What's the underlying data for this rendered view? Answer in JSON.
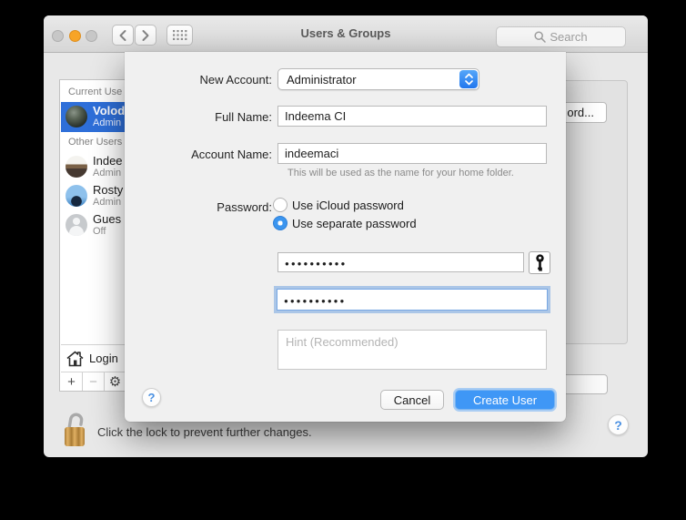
{
  "titlebar": {
    "title": "Users & Groups",
    "search_placeholder": "Search"
  },
  "sidebar": {
    "section_current": "Current Use",
    "section_other": "Other Users",
    "users": [
      {
        "name": "Volod",
        "role": "Admin"
      },
      {
        "name": "Indee",
        "role": "Admin"
      },
      {
        "name": "Rosty",
        "role": "Admin"
      },
      {
        "name": "Gues",
        "role": "Off"
      }
    ],
    "login_label": "Login",
    "add_label": "+",
    "remove_label": "−",
    "gear_glyph": "⚙"
  },
  "background_pane": {
    "partial_password_button": "ord..."
  },
  "sheet": {
    "new_account_label": "New Account:",
    "new_account_value": "Administrator",
    "full_name_label": "Full Name:",
    "full_name_value": "Indeema CI",
    "account_name_label": "Account Name:",
    "account_name_value": "indeemaci",
    "account_name_help": "This will be used as the name for your home folder.",
    "password_label": "Password:",
    "radio_icloud_label": "Use iCloud password",
    "radio_separate_label": "Use separate password",
    "password_value": "●●●●●●●●●●",
    "verify_value": "●●●●●●●●●●",
    "hint_placeholder": "Hint (Recommended)",
    "help_label": "?",
    "cancel_label": "Cancel",
    "create_label": "Create User"
  },
  "footer": {
    "lock_text": "Click the lock to prevent further changes.",
    "help_label": "?"
  },
  "colors": {
    "selection_blue": "#2e6fd9",
    "accent_blue": "#3f97f6",
    "traffic_orange": "#f7a427",
    "lock_gold": "#cf9a48"
  }
}
